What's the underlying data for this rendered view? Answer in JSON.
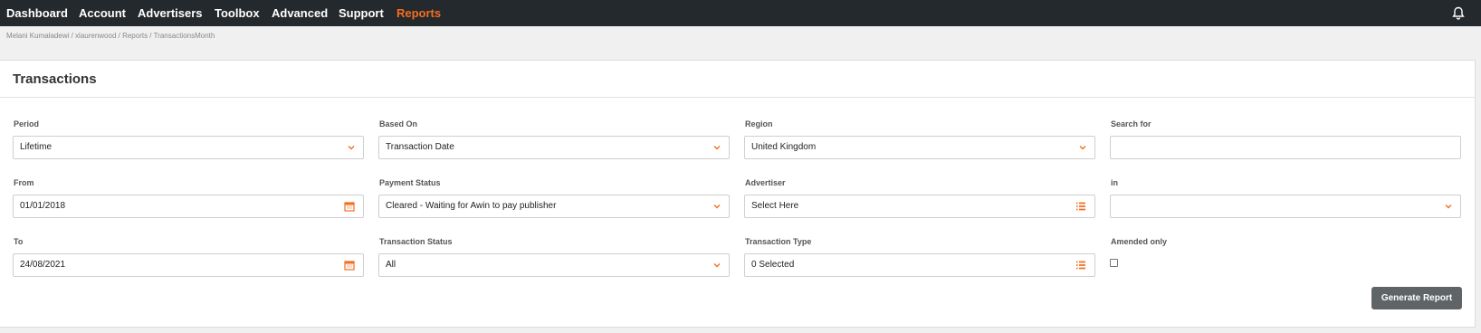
{
  "nav": {
    "items": [
      "Dashboard",
      "Account",
      "Advertisers",
      "Toolbox",
      "Advanced",
      "Support",
      "Reports"
    ],
    "active_color": "#f36d21",
    "bell_icon": "bell-icon"
  },
  "breadcrumb": "Melani Kumaladewi / xlaurenwood / Reports / TransactionsMonth",
  "page": {
    "title": "Transactions"
  },
  "form": {
    "period": {
      "label": "Period",
      "value": "Lifetime"
    },
    "based_on": {
      "label": "Based On",
      "value": "Transaction Date"
    },
    "region": {
      "label": "Region",
      "value": "United Kingdom"
    },
    "search_for": {
      "label": "Search for",
      "value": ""
    },
    "from": {
      "label": "From",
      "value": "01/01/2018"
    },
    "payment_status": {
      "label": "Payment Status",
      "value": "Cleared - Waiting for Awin to pay publisher"
    },
    "advertiser": {
      "label": "Advertiser",
      "value": "Select Here"
    },
    "in": {
      "label": "in",
      "value": ""
    },
    "to": {
      "label": "To",
      "value": "24/08/2021"
    },
    "transaction_status": {
      "label": "Transaction Status",
      "value": "All"
    },
    "transaction_type": {
      "label": "Transaction Type",
      "value": "0 Selected"
    },
    "amended_only": {
      "label": "Amended only",
      "checked": false
    }
  },
  "buttons": {
    "generate": "Generate Report"
  },
  "colors": {
    "accent": "#f36d21",
    "nav_bg": "#24292d",
    "button_bg": "#5f6467"
  }
}
